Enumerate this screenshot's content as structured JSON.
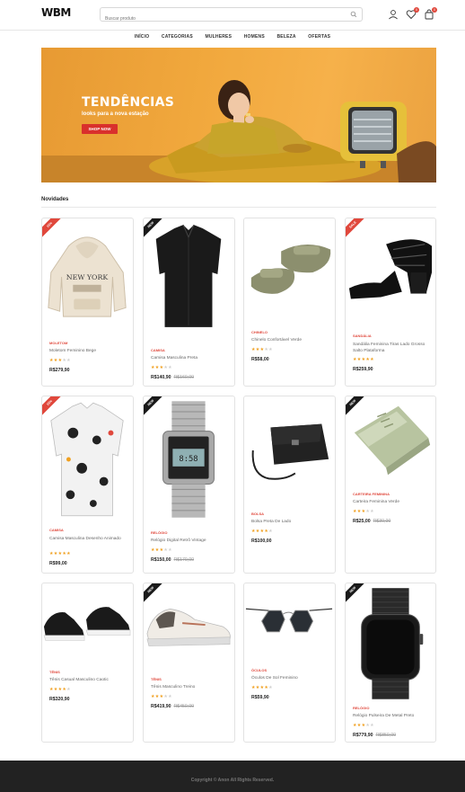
{
  "header": {
    "logo": "WBM",
    "logo_tagline": "",
    "search_placeholder": "Buscar produto",
    "wishlist_count": "0",
    "cart_count": "0"
  },
  "nav": [
    "INÍCIO",
    "CATEGORIAS",
    "MULHERES",
    "HOMENS",
    "BELEZA",
    "OFERTAS"
  ],
  "banner": {
    "title": "TENDÊNCIAS",
    "subtitle": "looks para a nova estação",
    "button": "SHOP NOW"
  },
  "section": {
    "title": "Novidades"
  },
  "products": [
    {
      "category": "Moletom",
      "name": "Moletom Feminino Bege",
      "rating": 3,
      "price": "R$279,90",
      "old_price": "",
      "badge": "sale",
      "badge_text": "15%",
      "icon": "hoodie-icon"
    },
    {
      "category": "Camisa",
      "name": "Camisa Masculina Preta",
      "rating": 3,
      "price": "R$140,90",
      "old_price": "R$160,00",
      "badge": "new",
      "badge_text": "NEW",
      "icon": "shirt-icon"
    },
    {
      "category": "Chinelo",
      "name": "Chinelo Confortável Verde",
      "rating": 3,
      "price": "R$58,00",
      "old_price": "",
      "badge": "",
      "badge_text": "",
      "icon": "sandal-icon"
    },
    {
      "category": "Sandália",
      "name": "Sandália Feminina Tiras Lado Grosso Salto Plataforma",
      "rating": 5,
      "price": "R$259,90",
      "old_price": "",
      "badge": "sale",
      "badge_text": "SALE",
      "icon": "heel-sandal-icon"
    },
    {
      "category": "Camisa",
      "name": "Camisa Masculina Desenho Animado",
      "rating": 5,
      "price": "R$99,00",
      "old_price": "",
      "badge": "sale",
      "badge_text": "15%",
      "icon": "print-shirt-icon"
    },
    {
      "category": "Relógio",
      "name": "Relógio Digital Retrô Vintage",
      "rating": 3,
      "price": "R$150,00",
      "old_price": "R$170,00",
      "badge": "new",
      "badge_text": "NEW",
      "icon": "digital-watch-icon"
    },
    {
      "category": "Bolsa",
      "name": "Bolsa Preta De Lado",
      "rating": 4,
      "price": "R$100,00",
      "old_price": "",
      "badge": "",
      "badge_text": "",
      "icon": "bag-icon"
    },
    {
      "category": "Carteira Feminina",
      "name": "Carteira Feminina Verde",
      "rating": 3,
      "price": "R$25,00",
      "old_price": "R$30,00",
      "badge": "new",
      "badge_text": "NEW",
      "icon": "wallet-icon"
    },
    {
      "category": "Tênis",
      "name": "Tênis Casual Masculino Caotic",
      "rating": 4,
      "price": "R$320,90",
      "old_price": "",
      "badge": "",
      "badge_text": "",
      "icon": "sneaker-black-icon"
    },
    {
      "category": "Tênis",
      "name": "Tênis Masculino Treino",
      "rating": 3,
      "price": "R$419,90",
      "old_price": "R$450,00",
      "badge": "new",
      "badge_text": "NEW",
      "icon": "sneaker-white-icon"
    },
    {
      "category": "Óculos",
      "name": "Óculos De Sol Feminino",
      "rating": 4,
      "price": "R$59,90",
      "old_price": "",
      "badge": "",
      "badge_text": "",
      "icon": "sunglasses-icon"
    },
    {
      "category": "Relógio",
      "name": "Relógio Pulseira De Metal Preto",
      "rating": 3,
      "price": "R$779,90",
      "old_price": "R$850,00",
      "badge": "new",
      "badge_text": "NEW",
      "icon": "smartwatch-icon"
    }
  ],
  "footer": {
    "text": "Copyright © Anon All Rights Reserved."
  },
  "colors": {
    "accent": "#e0483c",
    "banner": "#f1a83d",
    "star": "#f0a020",
    "footer": "#222222"
  }
}
